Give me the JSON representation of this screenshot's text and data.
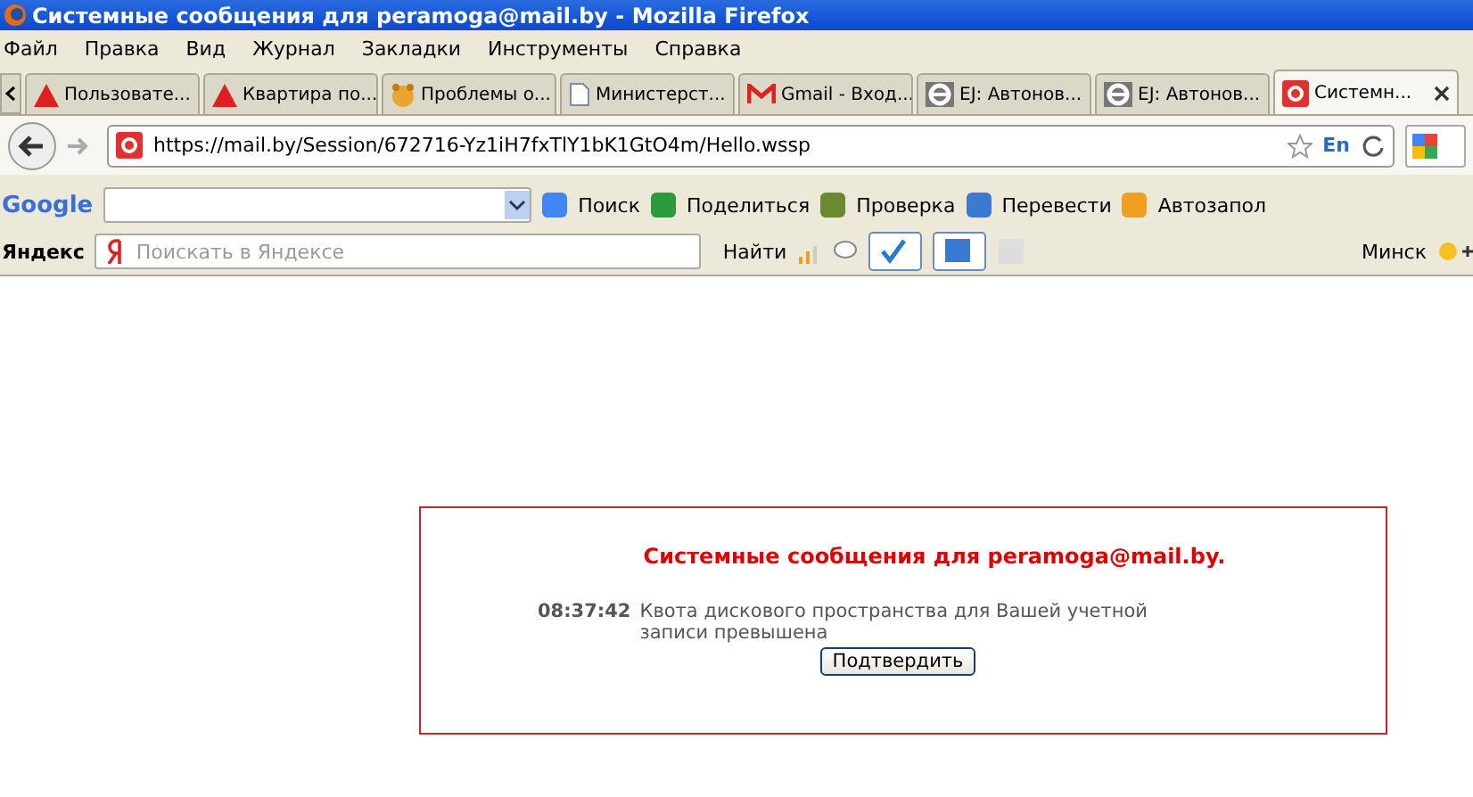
{
  "window": {
    "title": "Системные сообщения для peramoga@mail.by - Mozilla Firefox"
  },
  "menu": [
    "Файл",
    "Правка",
    "Вид",
    "Журнал",
    "Закладки",
    "Инструменты",
    "Справка"
  ],
  "tabs": [
    {
      "label": "Пользовате...",
      "kind": "triangle",
      "selected": false
    },
    {
      "label": "Квартира по...",
      "kind": "triangle",
      "selected": false
    },
    {
      "label": "Проблемы о...",
      "kind": "bear",
      "selected": false
    },
    {
      "label": "Министерст...",
      "kind": "page",
      "selected": false
    },
    {
      "label": "Gmail - Вход...",
      "kind": "gmail",
      "selected": false
    },
    {
      "label": "EJ: Автонов...",
      "kind": "e",
      "selected": false
    },
    {
      "label": "EJ: Автонов...",
      "kind": "e",
      "selected": false
    },
    {
      "label": "Системн...",
      "kind": "mailby",
      "selected": true
    }
  ],
  "address": {
    "url": "https://mail.by/Session/672716-Yz1iH7fxTlY1bK1GtO4m/Hello.wssp",
    "lang": "En"
  },
  "google_toolbar": {
    "logo": "Google",
    "items": [
      "Поиск",
      "Поделиться",
      "Проверка",
      "Перевести",
      "Автозапол"
    ]
  },
  "yandex_toolbar": {
    "logo": "Яндекс",
    "search_placeholder": "Поискать в Яндексе",
    "find": "Найти",
    "city": "Минск"
  },
  "message": {
    "title": "Системные сообщения для peramoga@mail.by.",
    "time": "08:37:42",
    "text": "Квота дискового пространства для Вашей учетной записи превышена",
    "button": "Подтвердить"
  }
}
